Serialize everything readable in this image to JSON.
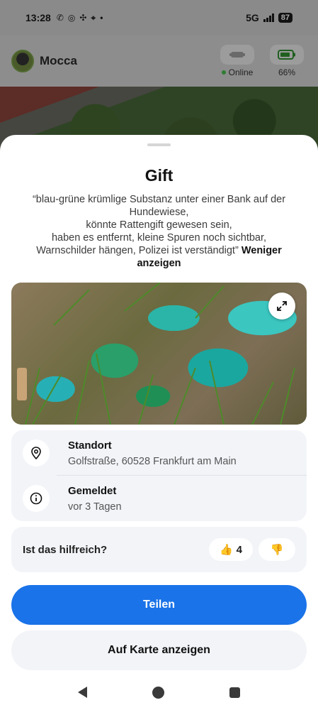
{
  "statusbar": {
    "time": "13:28",
    "network": "5G",
    "battery": "87"
  },
  "header": {
    "pet_name": "Mocca",
    "status": "Online",
    "battery_percent": "66%"
  },
  "sheet": {
    "title": "Gift",
    "description": "“blau-grüne krümlige Substanz unter einer Bank auf der Hundewiese, könnte Rattengift gewesen sein, haben es entfernt, kleine Spuren noch sichtbar, Warnschilder hängen, Polizei ist verständigt”",
    "description_lines": [
      "“blau-grüne krümlige Substanz unter einer Bank auf der Hundewiese,",
      "könnte Rattengift gewesen sein,",
      "haben es entfernt, kleine Spuren noch sichtbar,",
      "Warnschilder hängen, Polizei ist verständigt”"
    ],
    "less_label": "Weniger anzeigen",
    "location_label": "Standort",
    "location_value": "Golfstraße, 60528 Frankfurt am Main",
    "reported_label": "Gemeldet",
    "reported_value": "vor 3 Tagen",
    "helpful_question": "Ist das hilfreich?",
    "upvotes": "4",
    "share_label": "Teilen",
    "map_label": "Auf Karte anzeigen"
  },
  "icons": {
    "thumbs_up": "👍",
    "thumbs_down": "👎"
  },
  "colors": {
    "primary": "#1a73e8",
    "card_bg": "#f2f4f8",
    "online": "#2e7d32"
  }
}
